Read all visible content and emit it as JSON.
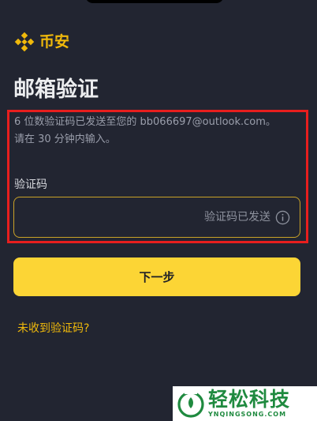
{
  "app": {
    "brand_name": "币安",
    "logo_icon": "binance-diamond-icon"
  },
  "page": {
    "title": "邮箱验证",
    "instruction_line1": "6 位数验证码已发送至您的 bb066697@outlook.com。",
    "instruction_line2": "请在 30 分钟内输入。"
  },
  "form": {
    "code_label": "验证码",
    "code_value": "",
    "code_status": "验证码已发送",
    "info_icon": "info-icon"
  },
  "actions": {
    "next_label": "下一步",
    "resend_label": "未收到验证码?"
  },
  "watermark": {
    "title": "轻松科技",
    "url": "YNQINGSONG.COM"
  },
  "colors": {
    "background": "#222531",
    "brand": "#F0B90B",
    "button": "#FCD535",
    "highlight": "#E81E1E"
  }
}
